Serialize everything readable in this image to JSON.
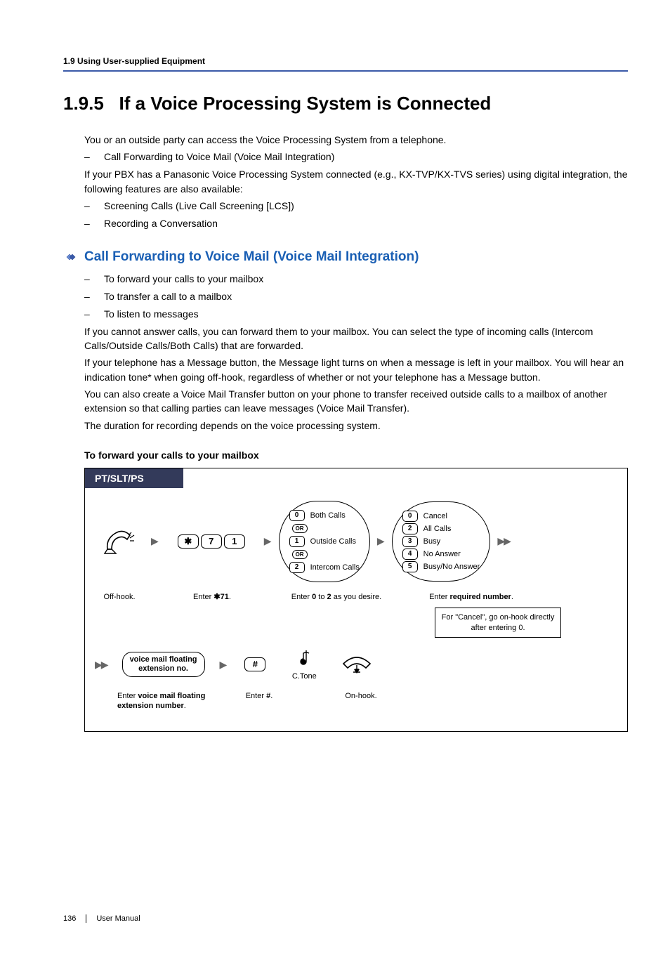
{
  "header": {
    "running": "1.9 Using User-supplied Equipment"
  },
  "section": {
    "number": "1.9.5",
    "title": "If a Voice Processing System is Connected"
  },
  "intro": {
    "p1": "You or an outside party can access the Voice Processing System from a telephone.",
    "bullet1": "Call Forwarding to Voice Mail (Voice Mail Integration)",
    "p2": "If your PBX has a Panasonic Voice Processing System connected (e.g., KX-TVP/KX-TVS series) using digital integration, the following features are also available:",
    "bullet2": "Screening Calls (Live Call Screening [LCS])",
    "bullet3": "Recording a Conversation"
  },
  "sub": {
    "title": "Call Forwarding to Voice Mail (Voice Mail Integration)",
    "b1": "To forward your calls to your mailbox",
    "b2": "To transfer a call to a mailbox",
    "b3": "To listen to messages",
    "p1": "If you cannot answer calls, you can forward them to your mailbox. You can select the type of incoming calls (Intercom Calls/Outside Calls/Both Calls) that are forwarded.",
    "p2": "If your telephone has a Message button, the Message light turns on when a message is left in your mailbox. You will hear an indication tone* when going off-hook, regardless of whether or not your telephone has a Message button.",
    "p3": "You can also create a Voice Mail Transfer button on your phone to transfer received outside calls to a mailbox of another extension so that calling parties can leave messages (Voice Mail Transfer).",
    "p4": "The duration for recording depends on the voice processing system."
  },
  "procedure": {
    "title": "To forward your calls to your mailbox",
    "header": "PT/SLT/PS",
    "steps": {
      "offhook": "Off-hook.",
      "enter71_pre": "Enter ",
      "enter71_key": "71",
      "enter71_post": ".",
      "star": "✱",
      "d7": "7",
      "d1": "1",
      "callType": {
        "d0": "0",
        "l0": "Both Calls",
        "d1": "1",
        "l1": "Outside Calls",
        "d2": "2",
        "l2": "Intercom Calls",
        "or": "OR",
        "caption_pre": "Enter ",
        "caption_b1": "0",
        "caption_mid": " to ",
        "caption_b2": "2",
        "caption_post": " as you desire."
      },
      "fwdType": {
        "d0": "0",
        "l0": "Cancel",
        "d2": "2",
        "l2": "All Calls",
        "d3": "3",
        "l3": "Busy",
        "d4": "4",
        "l4": "No Answer",
        "d5": "5",
        "l5": "Busy/No Answer",
        "caption_pre": "Enter ",
        "caption_b": "required number",
        "caption_post": "."
      },
      "note": "For \"Cancel\", go on-hook directly after entering 0.",
      "vmext": {
        "label": "voice mail floating\nextension no.",
        "caption_pre": "Enter ",
        "caption_b": "voice mail floating extension number",
        "caption_post": "."
      },
      "hash": "#",
      "hash_caption_pre": "Enter ",
      "hash_caption_b": "#",
      "hash_caption_post": ".",
      "ctone": "C.Tone",
      "onhook": "On-hook."
    }
  },
  "footer": {
    "page": "136",
    "doc": "User Manual"
  }
}
